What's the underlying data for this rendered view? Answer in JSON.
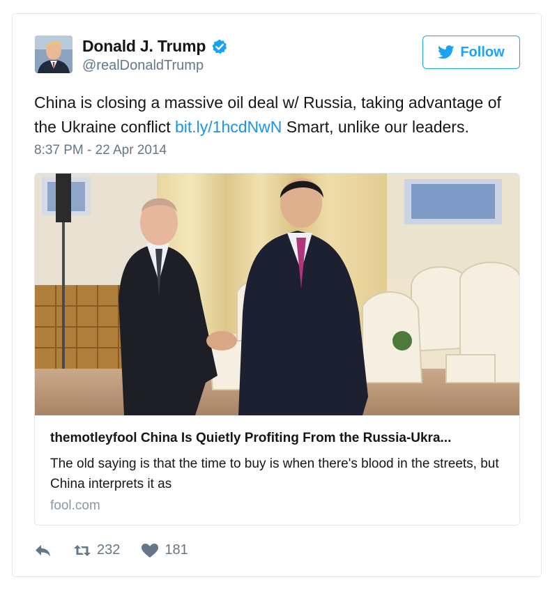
{
  "user": {
    "display_name": "Donald J. Trump",
    "screen_name": "@realDonaldTrump",
    "verified": true
  },
  "follow_button": {
    "label": "Follow"
  },
  "tweet": {
    "text_part1": "China is closing a massive oil deal w/ Russia, taking advantage of the Ukraine conflict ",
    "link_text": "bit.ly/1hcdNwN",
    "text_part2": " Smart, unlike our leaders.",
    "timestamp": "8:37 PM - 22 Apr 2014"
  },
  "link_card": {
    "title": "themotleyfool China Is Quietly Profiting From the Russia-Ukra...",
    "description": "The old saying is that the time to buy is when there's blood in the streets, but China interprets it as",
    "domain": "fool.com"
  },
  "actions": {
    "retweet_count": "232",
    "like_count": "181"
  },
  "colors": {
    "accent": "#1da1f2",
    "link": "#1b95e0",
    "muted": "#657786",
    "border": "#e1e8ed"
  },
  "icons": [
    "verified-badge-icon",
    "twitter-bird-icon",
    "reply-icon",
    "retweet-icon",
    "heart-icon"
  ]
}
